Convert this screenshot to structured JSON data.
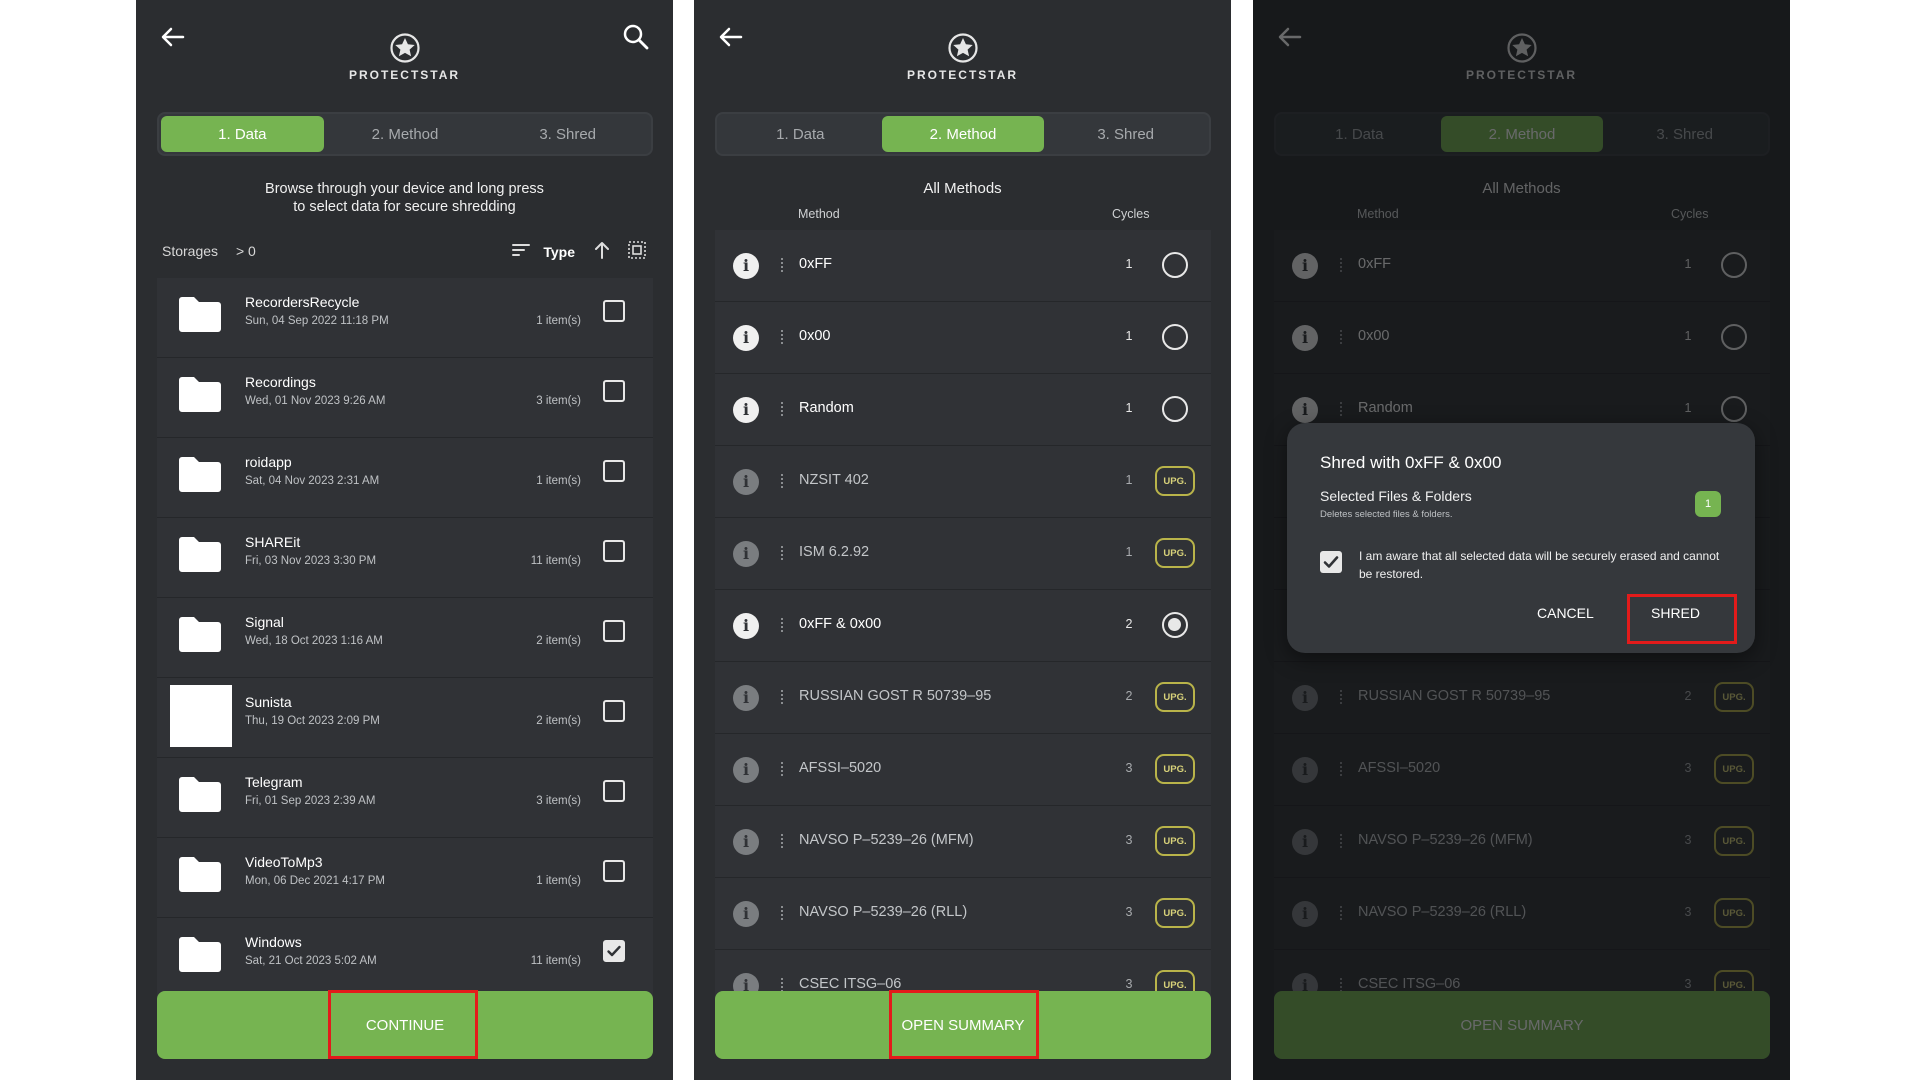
{
  "brand": "PROTECTSTAR",
  "tabs": [
    "1. Data",
    "2. Method",
    "3. Shred"
  ],
  "screen1": {
    "hint_line1": "Browse through your device and long press",
    "hint_line2": "to select data for secure shredding",
    "storages_label": "Storages",
    "path": "> 0",
    "sort_label": "Type",
    "files": [
      {
        "name": "RecordersRecycle",
        "date": "Sun, 04 Sep 2022 11:18 PM",
        "count": "1 item(s)",
        "checked": false,
        "thumb": "folder"
      },
      {
        "name": "Recordings",
        "date": "Wed, 01 Nov 2023 9:26 AM",
        "count": "3 item(s)",
        "checked": false,
        "thumb": "folder"
      },
      {
        "name": "roidapp",
        "date": "Sat, 04 Nov 2023 2:31 AM",
        "count": "1 item(s)",
        "checked": false,
        "thumb": "folder"
      },
      {
        "name": "SHAREit",
        "date": "Fri, 03 Nov 2023 3:30 PM",
        "count": "11 item(s)",
        "checked": false,
        "thumb": "folder"
      },
      {
        "name": "Signal",
        "date": "Wed, 18 Oct 2023 1:16 AM",
        "count": "2 item(s)",
        "checked": false,
        "thumb": "folder"
      },
      {
        "name": "Sunista",
        "date": "Thu, 19 Oct 2023 2:09 PM",
        "count": "2 item(s)",
        "checked": false,
        "thumb": "blank"
      },
      {
        "name": "Telegram",
        "date": "Fri, 01 Sep 2023 2:39 AM",
        "count": "3 item(s)",
        "checked": false,
        "thumb": "folder"
      },
      {
        "name": "VideoToMp3",
        "date": "Mon, 06 Dec 2021 4:17 PM",
        "count": "1 item(s)",
        "checked": false,
        "thumb": "folder"
      },
      {
        "name": "Windows",
        "date": "Sat, 21 Oct 2023 5:02 AM",
        "count": "11 item(s)",
        "checked": true,
        "thumb": "folder"
      }
    ],
    "continue_label": "CONTINUE"
  },
  "screen2": {
    "title": "All Methods",
    "col_method": "Method",
    "col_cycles": "Cycles",
    "methods": [
      {
        "name": "0xFF",
        "cycles": "1",
        "locked": false,
        "selected": false
      },
      {
        "name": "0x00",
        "cycles": "1",
        "locked": false,
        "selected": false
      },
      {
        "name": "Random",
        "cycles": "1",
        "locked": false,
        "selected": false
      },
      {
        "name": "NZSIT 402",
        "cycles": "1",
        "locked": true,
        "selected": false
      },
      {
        "name": "ISM 6.2.92",
        "cycles": "1",
        "locked": true,
        "selected": false
      },
      {
        "name": "0xFF & 0x00",
        "cycles": "2",
        "locked": false,
        "selected": true
      },
      {
        "name": "RUSSIAN GOST R 50739–95",
        "cycles": "2",
        "locked": true,
        "selected": false
      },
      {
        "name": "AFSSI–5020",
        "cycles": "3",
        "locked": true,
        "selected": false
      },
      {
        "name": "NAVSO P–5239–26 (MFM)",
        "cycles": "3",
        "locked": true,
        "selected": false
      },
      {
        "name": "NAVSO P–5239–26 (RLL)",
        "cycles": "3",
        "locked": true,
        "selected": false
      },
      {
        "name": "CSEC ITSG–06",
        "cycles": "3",
        "locked": true,
        "selected": false
      }
    ],
    "upgrade_label": "UPG.",
    "open_summary_label": "OPEN SUMMARY"
  },
  "screen3": {
    "dialog_title": "Shred with 0xFF & 0x00",
    "selected_label": "Selected Files & Folders",
    "selected_desc": "Deletes selected files & folders.",
    "selected_count": "1",
    "ack_text": "I am aware that all selected data will be securely erased and cannot be restored.",
    "cancel_label": "CANCEL",
    "shred_label": "SHRED"
  },
  "colors": {
    "accent_green": "#76b451",
    "panel_bg": "#2b2d30",
    "highlight_red": "#e31b1b",
    "upgrade_yellow": "#b9b44a"
  }
}
